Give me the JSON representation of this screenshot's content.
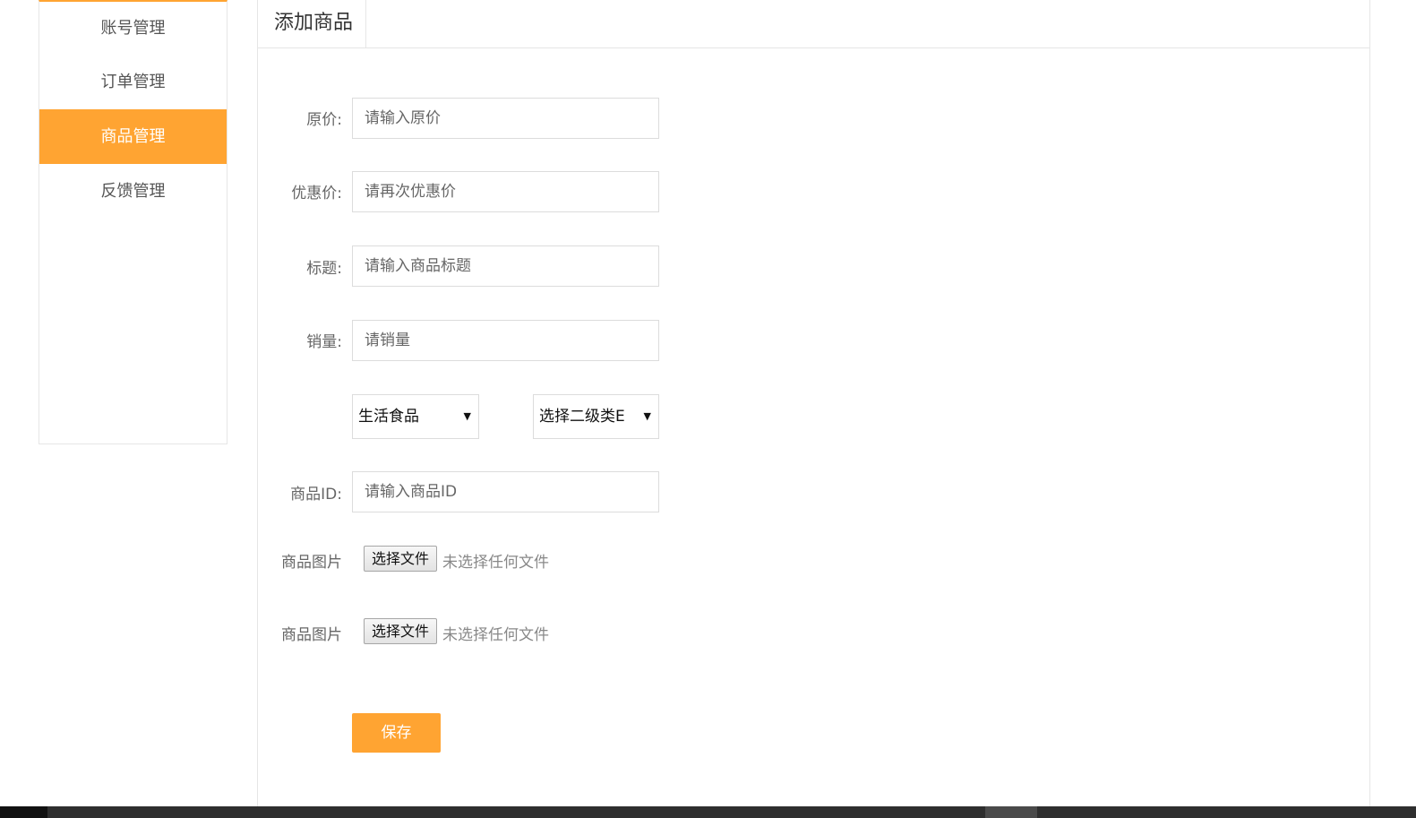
{
  "sidebar": {
    "items": [
      {
        "label": "账号管理"
      },
      {
        "label": "订单管理"
      },
      {
        "label": "商品管理"
      },
      {
        "label": "反馈管理"
      }
    ]
  },
  "panel": {
    "tab_title": "添加商品"
  },
  "form": {
    "original_price": {
      "label": "原价:",
      "placeholder": "请输入原价"
    },
    "discount_price": {
      "label": "优惠价:",
      "placeholder": "请再次优惠价"
    },
    "title": {
      "label": "标题:",
      "placeholder": "请输入商品标题"
    },
    "sales": {
      "label": "销量:",
      "placeholder": "请销量"
    },
    "category1": {
      "selected": "生活食品"
    },
    "category2": {
      "selected": "选择二级类E"
    },
    "product_id": {
      "label": "商品ID:",
      "placeholder": "请输入商品ID"
    },
    "image1": {
      "label": "商品图片",
      "button": "选择文件",
      "status": "未选择任何文件"
    },
    "image2": {
      "label": "商品图片",
      "button": "选择文件",
      "status": "未选择任何文件"
    },
    "save_label": "保存"
  },
  "colors": {
    "accent": "#ffa432",
    "border": "#e6e6e6"
  },
  "icons": {
    "select_arrow": "caret-down-icon"
  }
}
